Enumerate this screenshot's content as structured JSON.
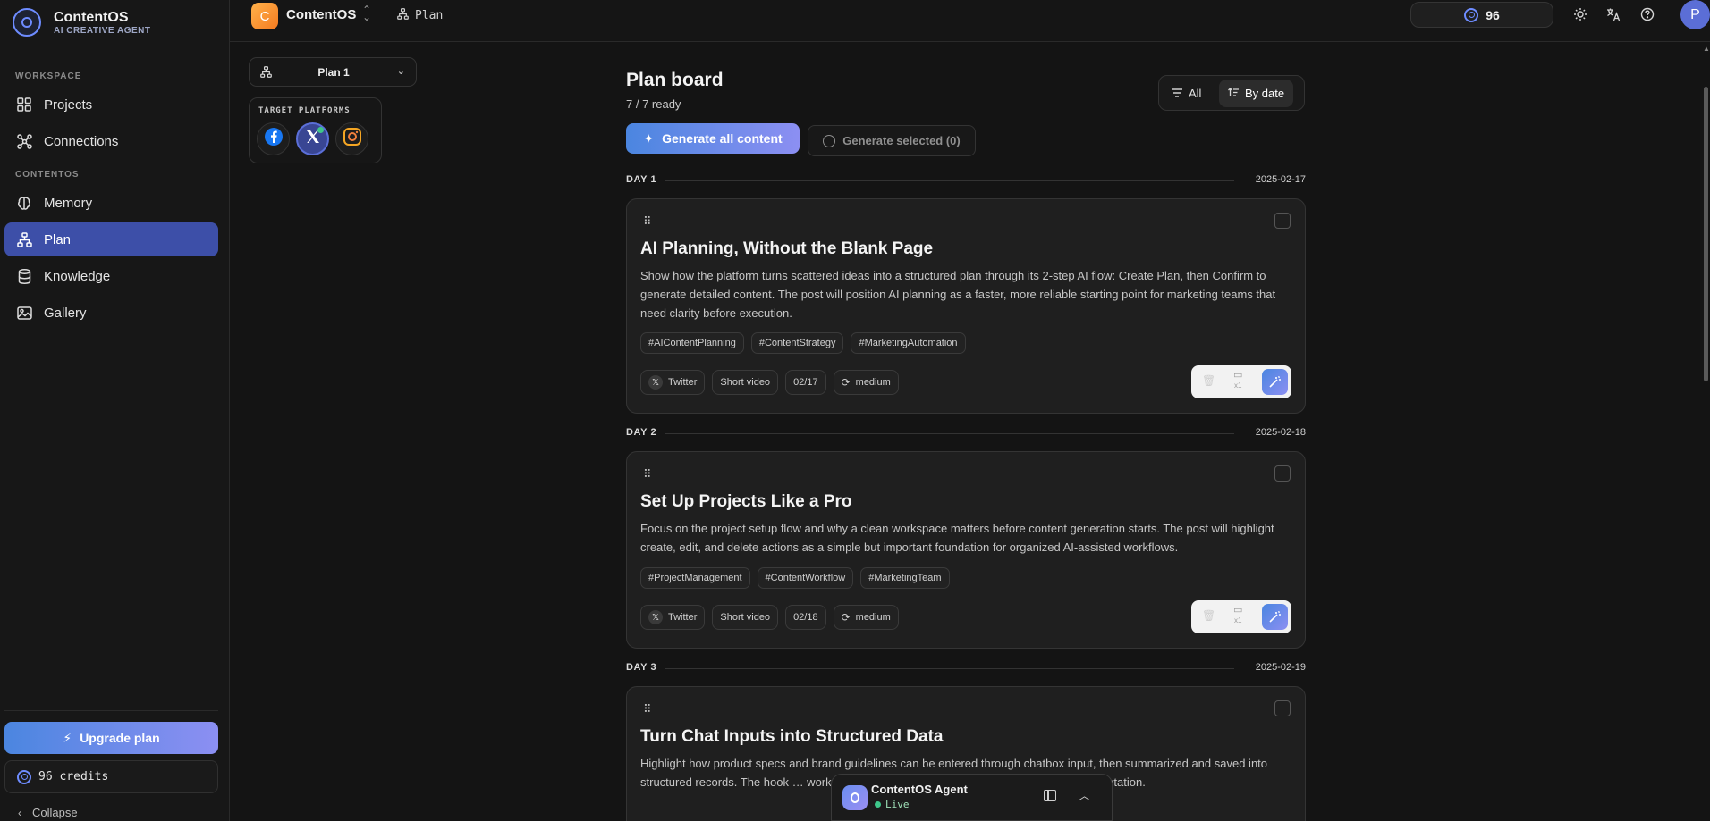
{
  "brand": {
    "name": "ContentOS",
    "tagline": "AI CREATIVE AGENT"
  },
  "sidebar": {
    "sections": [
      {
        "label": "WORKSPACE",
        "items": [
          {
            "label": "Projects",
            "icon": "grid-icon"
          },
          {
            "label": "Connections",
            "icon": "connections-icon"
          }
        ]
      },
      {
        "label": "CONTENTOS",
        "items": [
          {
            "label": "Memory",
            "icon": "brain-icon"
          },
          {
            "label": "Plan",
            "icon": "plan-icon",
            "active": true
          },
          {
            "label": "Knowledge",
            "icon": "database-icon"
          },
          {
            "label": "Gallery",
            "icon": "image-icon"
          }
        ]
      }
    ],
    "upgrade_label": "Upgrade plan",
    "credits_label": "96 credits",
    "collapse_label": "Collapse"
  },
  "topbar": {
    "project_initial": "C",
    "project_name": "ContentOS",
    "breadcrumb": "Plan",
    "credits": "96",
    "icons": [
      "sun-icon",
      "translate-icon",
      "help-icon"
    ],
    "user_initial": "P"
  },
  "controls": {
    "plan_select": "Plan 1",
    "platforms_title": "TARGET PLATFORMS",
    "platforms": [
      {
        "name": "facebook",
        "selected": false
      },
      {
        "name": "x",
        "selected": true
      },
      {
        "name": "instagram",
        "selected": false
      }
    ]
  },
  "board": {
    "title": "Plan board",
    "subtitle": "7 / 7 ready",
    "filter_all": "All",
    "filter_by_date": "By date",
    "generate_all": "Generate all content",
    "generate_selected": "Generate selected (0)"
  },
  "days": [
    {
      "label": "DAY 1",
      "date": "2025-02-17",
      "card": {
        "title": "AI Planning, Without the Blank Page",
        "description": "Show how the platform turns scattered ideas into a structured plan through its 2-step AI flow: Create Plan, then Confirm to generate detailed content. The post will position AI planning as a faster, more reliable starting point for marketing teams that need clarity before execution.",
        "tags": [
          "#AIContentPlanning",
          "#ContentStrategy",
          "#MarketingAutomation"
        ],
        "platform": "Twitter",
        "format": "Short video",
        "date_short": "02/17",
        "effort": "medium",
        "count": "x1"
      }
    },
    {
      "label": "DAY 2",
      "date": "2025-02-18",
      "card": {
        "title": "Set Up Projects Like a Pro",
        "description": "Focus on the project setup flow and why a clean workspace matters before content generation starts. The post will highlight create, edit, and delete actions as a simple but important foundation for organized AI-assisted workflows.",
        "tags": [
          "#ProjectManagement",
          "#ContentWorkflow",
          "#MarketingTeam"
        ],
        "platform": "Twitter",
        "format": "Short video",
        "date_short": "02/18",
        "effort": "medium",
        "count": "x1"
      }
    },
    {
      "label": "DAY 3",
      "date": "2025-02-19",
      "card": {
        "title": "Turn Chat Inputs into Structured Data",
        "description": "Highlight how product specs and brand guidelines can be entered through chatbox input, then summarized and saved into structured records. The hook … work while making raw input usable for AI and RAG interpretation."
      }
    }
  ],
  "agent": {
    "name": "ContentOS Agent",
    "status": "Live"
  },
  "colors": {
    "accent": "#3d4fa8",
    "gradient_start": "#4b86e0",
    "gradient_end": "#8c8ff2",
    "live": "#3ec68a",
    "project_avatar": "#f47b20"
  }
}
